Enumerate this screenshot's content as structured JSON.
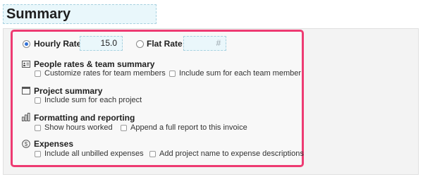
{
  "title": "Summary",
  "rates": {
    "hourly_label": "Hourly Rate",
    "hourly_value": "15.0",
    "flat_label": "Flat Rate",
    "flat_placeholder": "#",
    "selected": "hourly"
  },
  "sections": [
    {
      "title": "People rates & team summary",
      "icon": "people-card-icon",
      "options": [
        "Customize rates for team members",
        "Include sum for each team member"
      ]
    },
    {
      "title": "Project summary",
      "icon": "project-window-icon",
      "options": [
        "Include sum for each project"
      ]
    },
    {
      "title": "Formatting and reporting",
      "icon": "bar-chart-icon",
      "options": [
        "Show hours worked",
        "Append a full report to this invoice"
      ]
    },
    {
      "title": "Expenses",
      "icon": "dollar-icon",
      "options": [
        "Include all unbilled expenses",
        "Add project name to expense descriptions"
      ]
    }
  ],
  "colors": {
    "highlight": "#ee3b72",
    "radio_selected": "#2f6fd6",
    "input_bg": "#eaf7fb"
  }
}
